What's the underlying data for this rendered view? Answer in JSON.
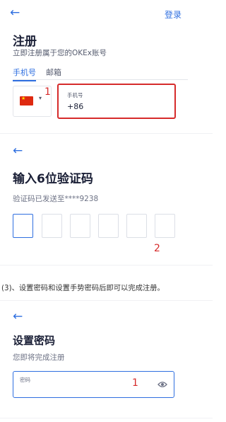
{
  "register": {
    "back_icon": "arrow-left-icon",
    "login_label": "登录",
    "title": "注册",
    "subtitle": "立即注册属于您的OKEx账号",
    "tabs": [
      {
        "label": "手机号",
        "active": true
      },
      {
        "label": "邮箱",
        "active": false
      }
    ],
    "country_flag": "cn-flag-icon",
    "marker": "1",
    "phone_field": {
      "label": "手机号",
      "value": "+86"
    }
  },
  "verify": {
    "back_icon": "arrow-left-icon",
    "title": "输入6位验证码",
    "subtitle": "验证码已发送至****9238",
    "code_boxes": 6,
    "marker": "2"
  },
  "caption": "(3)、设置密码和设置手势密码后即可以完成注册。",
  "set_password": {
    "back_icon": "arrow-left-icon",
    "title": "设置密码",
    "subtitle": "您即将完成注册",
    "password_field": {
      "label": "密码",
      "value": ""
    },
    "marker": "1",
    "eye_icon": "eye-icon"
  },
  "colors": {
    "accent": "#2f6fe0",
    "marker": "#d62b2b",
    "text": "#1a1f36"
  }
}
